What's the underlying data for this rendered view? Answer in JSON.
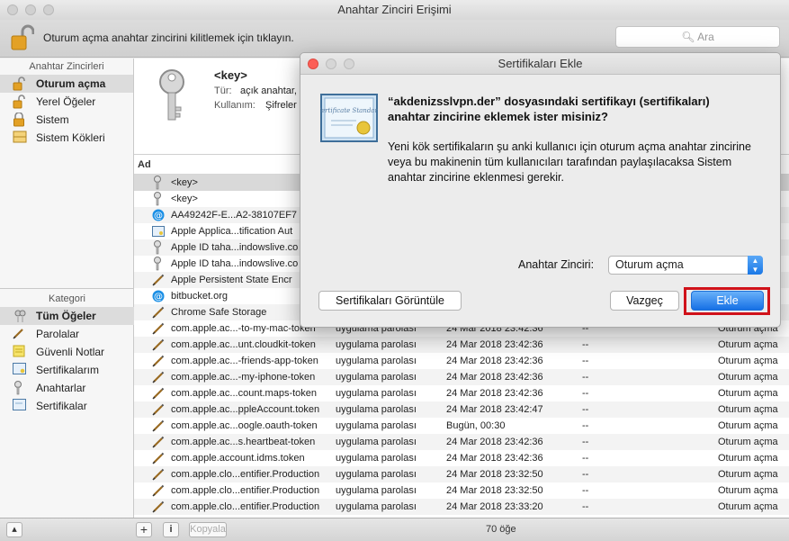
{
  "window": {
    "title": "Anahtar Zinciri Erişimi"
  },
  "toolbar": {
    "lock_text": "Oturum açma anahtar zincirini kilitlemek için tıklayın.",
    "search_placeholder": "Ara"
  },
  "sidebar": {
    "keychains_header": "Anahtar Zincirleri",
    "keychains": [
      {
        "label": "Oturum açma",
        "icon": "lock-open-icon",
        "selected": true
      },
      {
        "label": "Yerel Öğeler",
        "icon": "lock-open-icon",
        "selected": false
      },
      {
        "label": "Sistem",
        "icon": "lock-icon",
        "selected": false
      },
      {
        "label": "Sistem Kökleri",
        "icon": "cabinet-icon",
        "selected": false
      }
    ],
    "category_header": "Kategori",
    "categories": [
      {
        "label": "Tüm Öğeler",
        "icon": "all-items-icon",
        "selected": true
      },
      {
        "label": "Parolalar",
        "icon": "password-icon",
        "selected": false
      },
      {
        "label": "Güvenli Notlar",
        "icon": "note-icon",
        "selected": false
      },
      {
        "label": "Sertifikalarım",
        "icon": "my-certificate-icon",
        "selected": false
      },
      {
        "label": "Anahtarlar",
        "icon": "key-icon",
        "selected": false
      },
      {
        "label": "Sertifikalar",
        "icon": "certificate-icon",
        "selected": false
      }
    ]
  },
  "info": {
    "name": "<key>",
    "kind_label": "Tür:",
    "kind_value": "açık anahtar,",
    "usage_label": "Kullanım:",
    "usage_value": "Şifreler"
  },
  "table": {
    "col_name": "Ad",
    "rows": [
      {
        "icon": "key",
        "name": "<key>",
        "kind": "",
        "date": "",
        "expires": "",
        "keychain": ""
      },
      {
        "icon": "key",
        "name": "<key>",
        "kind": "",
        "date": "",
        "expires": "",
        "keychain": ""
      },
      {
        "icon": "at",
        "name": "AA49242F-E...A2-38107EF7",
        "kind": "",
        "date": "",
        "expires": "",
        "keychain": ""
      },
      {
        "icon": "cert",
        "name": "Apple Applica...tification Aut",
        "kind": "",
        "date": "",
        "expires": "",
        "keychain": ""
      },
      {
        "icon": "key",
        "name": "Apple ID taha...indowslive.co",
        "kind": "",
        "date": "",
        "expires": "",
        "keychain": ""
      },
      {
        "icon": "key",
        "name": "Apple ID taha...indowslive.co",
        "kind": "",
        "date": "",
        "expires": "",
        "keychain": ""
      },
      {
        "icon": "pen",
        "name": "Apple Persistent State Encr",
        "kind": "",
        "date": "",
        "expires": "",
        "keychain": ""
      },
      {
        "icon": "at",
        "name": "bitbucket.org",
        "kind": "",
        "date": "",
        "expires": "",
        "keychain": ""
      },
      {
        "icon": "pen",
        "name": "Chrome Safe Storage",
        "kind": "",
        "date": "",
        "expires": "",
        "keychain": ""
      },
      {
        "icon": "pen",
        "name": "com.apple.ac...-to-my-mac-token",
        "kind": "uygulama parolası",
        "date": "24 Mar 2018 23:42:36",
        "expires": "--",
        "keychain": "Oturum açma"
      },
      {
        "icon": "pen",
        "name": "com.apple.ac...unt.cloudkit-token",
        "kind": "uygulama parolası",
        "date": "24 Mar 2018 23:42:36",
        "expires": "--",
        "keychain": "Oturum açma"
      },
      {
        "icon": "pen",
        "name": "com.apple.ac...-friends-app-token",
        "kind": "uygulama parolası",
        "date": "24 Mar 2018 23:42:36",
        "expires": "--",
        "keychain": "Oturum açma"
      },
      {
        "icon": "pen",
        "name": "com.apple.ac...-my-iphone-token",
        "kind": "uygulama parolası",
        "date": "24 Mar 2018 23:42:36",
        "expires": "--",
        "keychain": "Oturum açma"
      },
      {
        "icon": "pen",
        "name": "com.apple.ac...count.maps-token",
        "kind": "uygulama parolası",
        "date": "24 Mar 2018 23:42:36",
        "expires": "--",
        "keychain": "Oturum açma"
      },
      {
        "icon": "pen",
        "name": "com.apple.ac...ppleAccount.token",
        "kind": "uygulama parolası",
        "date": "24 Mar 2018 23:42:47",
        "expires": "--",
        "keychain": "Oturum açma"
      },
      {
        "icon": "pen",
        "name": "com.apple.ac...oogle.oauth-token",
        "kind": "uygulama parolası",
        "date": "Bugün, 00:30",
        "expires": "--",
        "keychain": "Oturum açma"
      },
      {
        "icon": "pen",
        "name": "com.apple.ac...s.heartbeat-token",
        "kind": "uygulama parolası",
        "date": "24 Mar 2018 23:42:36",
        "expires": "--",
        "keychain": "Oturum açma"
      },
      {
        "icon": "pen",
        "name": "com.apple.account.idms.token",
        "kind": "uygulama parolası",
        "date": "24 Mar 2018 23:42:36",
        "expires": "--",
        "keychain": "Oturum açma"
      },
      {
        "icon": "pen",
        "name": "com.apple.clo...entifier.Production",
        "kind": "uygulama parolası",
        "date": "24 Mar 2018 23:32:50",
        "expires": "--",
        "keychain": "Oturum açma"
      },
      {
        "icon": "pen",
        "name": "com.apple.clo...entifier.Production",
        "kind": "uygulama parolası",
        "date": "24 Mar 2018 23:32:50",
        "expires": "--",
        "keychain": "Oturum açma"
      },
      {
        "icon": "pen",
        "name": "com.apple.clo...entifier.Production",
        "kind": "uygulama parolası",
        "date": "24 Mar 2018 23:33:20",
        "expires": "--",
        "keychain": "Oturum açma"
      }
    ]
  },
  "status": {
    "copy_label": "Kopyala",
    "count": "70 öğe"
  },
  "dialog": {
    "title": "Sertifikaları Ekle",
    "headline": "“akdenizsslvpn.der” dosyasındaki sertifikayı (sertifikaları) anahtar zincirine eklemek ister misiniz?",
    "body": "Yeni kök sertifikaların şu anki kullanıcı için oturum açma anahtar zincirine veya bu makinenin tüm kullanıcıları tarafından paylaşılacaksa Sistem anahtar zincirine eklenmesi gerekir.",
    "keychain_label": "Anahtar Zinciri:",
    "keychain_value": "Oturum açma",
    "view_button": "Sertifikaları Görüntüle",
    "cancel_button": "Vazgeç",
    "add_button": "Ekle",
    "cert_image_text": "Certificate Standard"
  },
  "colors": {
    "accent": "#1a78e6",
    "highlight": "#d0121a"
  }
}
